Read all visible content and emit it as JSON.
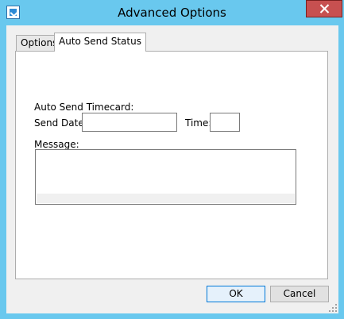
{
  "window": {
    "title": "Advanced Options"
  },
  "icons": {
    "app": "app-logo-icon",
    "close": "close-icon",
    "grip": "resize-grip-icon"
  },
  "tabs": [
    {
      "label": "Options",
      "selected": false
    },
    {
      "label": "Auto Send Status",
      "selected": true
    }
  ],
  "auto_send": {
    "section_label": "Auto Send Timecard:",
    "send_date_label": "Send Date:",
    "send_date_value": "",
    "time_label": "Time:",
    "time_value": "",
    "message_label": "Message:",
    "message_value": ""
  },
  "buttons": {
    "ok": "OK",
    "cancel": "Cancel"
  },
  "colors": {
    "frame": "#69C8EE",
    "close": "#C75050",
    "face": "#F0F0F0",
    "focus": "#0078D7"
  }
}
